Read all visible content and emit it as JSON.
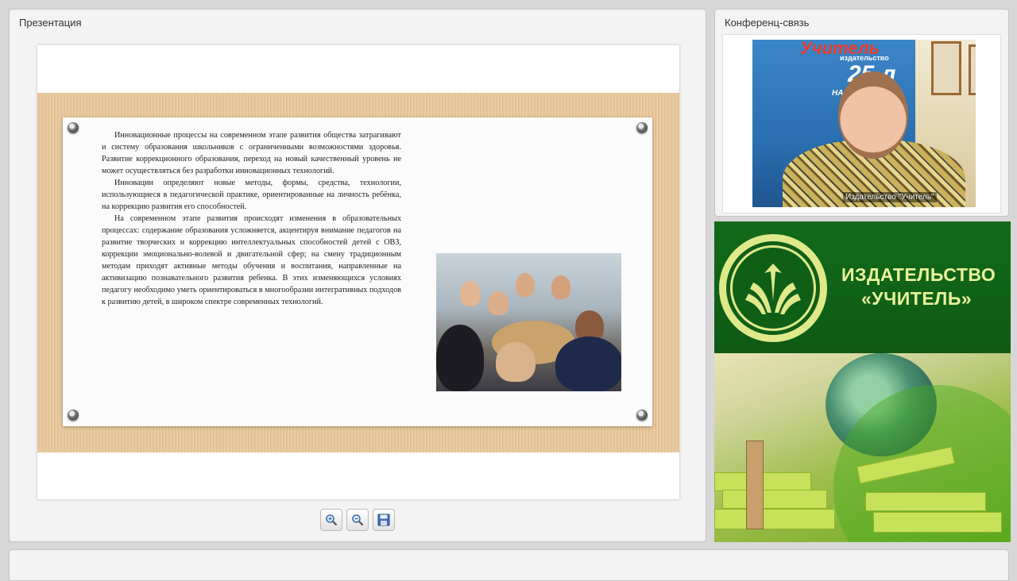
{
  "presentation_panel": {
    "title": "Презентация",
    "slide": {
      "paragraphs": [
        "Инновационные процессы на современном этапе развития общества затрагивают и систему образования школьников с ограниченными возможностями здоровья. Развитие коррекционного образования, переход на новый качественный уровень не может осуществляться без разработки инновационных технологий.",
        "Инновации определяют новые методы, формы, средства, технологии, использующиеся в педагогической практике, ориентированные на личность ребёнка, на коррекцию развития его способностей.",
        "На современном этапе развития происходят изменения в образовательных процессах: содержание образования усложняется, акцентируя внимание педагогов на развитие творческих и коррекцию интеллектуальных способностей детей с ОВЗ, коррекции эмоционально-волевой и двигательной сфер; на смену традиционным методам приходят активные методы обучения и воспитания, направленные на активизацию познавательного развития ребенка. В этих изменяющихся условиях педагогу необходимо уметь ориентироваться в многообразии интегративных подходов к развитию детей, в широком спектре современных технологий."
      ]
    },
    "toolbar": {
      "icons": [
        "zoom-in-icon",
        "zoom-out-icon",
        "save-icon"
      ]
    }
  },
  "conference_panel": {
    "title": "Конференц-связь",
    "video": {
      "caption": "Издательство \"Учитель\"",
      "poster_title": "Учитель",
      "poster_sub": "издательство",
      "poster_num": "25 л",
      "poster_line": "НА КНИЖН"
    }
  },
  "banner": {
    "line1": "ИЗДАТЕЛЬСТВО",
    "line2": "«УЧИТЕЛЬ»",
    "colors": {
      "green": "#0e5a15",
      "accent": "#e9f29a"
    }
  }
}
